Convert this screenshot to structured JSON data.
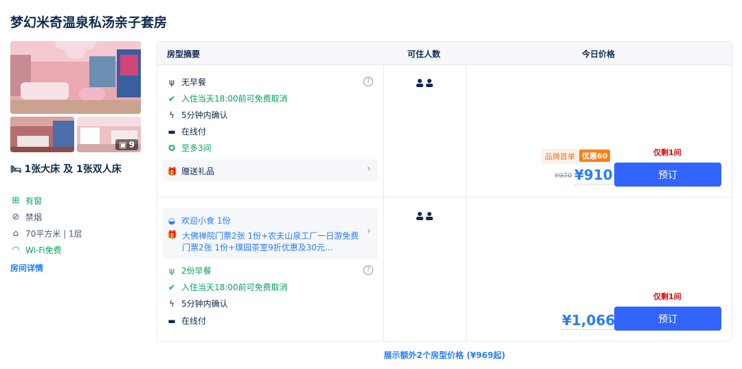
{
  "room": {
    "title": "梦幻米奇温泉私汤亲子套房",
    "photo_count": "9",
    "bed": "1张大床 及 1张双人床",
    "attributes": [
      {
        "icon": "window-icon",
        "label": "有窗",
        "color": "#06a35a"
      },
      {
        "icon": "no-smoking-icon",
        "label": "禁烟"
      },
      {
        "icon": "area-icon",
        "label": "70平方米 | 1层"
      },
      {
        "icon": "wifi-icon",
        "label": "Wi-Fi免费",
        "color": "#06a35a"
      }
    ],
    "details_link": "房间详情"
  },
  "table": {
    "headers": {
      "summary": "房型摘要",
      "guests": "可住人数",
      "price": "今日价格"
    }
  },
  "offers": [
    {
      "features": [
        {
          "icon": "utensils-icon",
          "label": "无早餐"
        },
        {
          "icon": "check-circle-icon",
          "label": "入住当天18:00前可免费取消",
          "color": "#06a35a"
        },
        {
          "icon": "bolt-icon",
          "label": "5分钟内确认"
        },
        {
          "icon": "card-icon",
          "label": "在线付"
        },
        {
          "icon": "star-circle-icon",
          "label": "至多3间",
          "color": "#06a35a"
        }
      ],
      "gift": "赠送礼品",
      "guests": 2,
      "tags": {
        "brand": "品牌首单",
        "discount": "优惠60"
      },
      "original_price": "¥970",
      "price": "¥910",
      "rooms_left": "仅剩1间",
      "book_label": "预订"
    },
    {
      "bundle": {
        "snack": "欢迎小食 1份",
        "package_text": "大佛禅院门票2张 1份+农夫山泉工厂一日游免费门票2张 1份+璞园茶室9折优惠及30元..."
      },
      "features": [
        {
          "icon": "utensils-icon",
          "label": "2份早餐",
          "color": "#06a35a"
        },
        {
          "icon": "check-circle-icon",
          "label": "入住当天18:00前可免费取消",
          "color": "#06a35a"
        },
        {
          "icon": "bolt-icon",
          "label": "5分钟内确认"
        },
        {
          "icon": "card-icon",
          "label": "在线付"
        }
      ],
      "guests": 2,
      "price": "¥1,066",
      "rooms_left": "仅剩1间",
      "book_label": "预订"
    }
  ],
  "more_link": "展示额外2个房型价格 (¥969起)",
  "colors": {
    "accent": "#287dfa",
    "button": "#3264ff",
    "green": "#06a35a",
    "alert": "#e00000",
    "orange": "#ff7d13"
  }
}
